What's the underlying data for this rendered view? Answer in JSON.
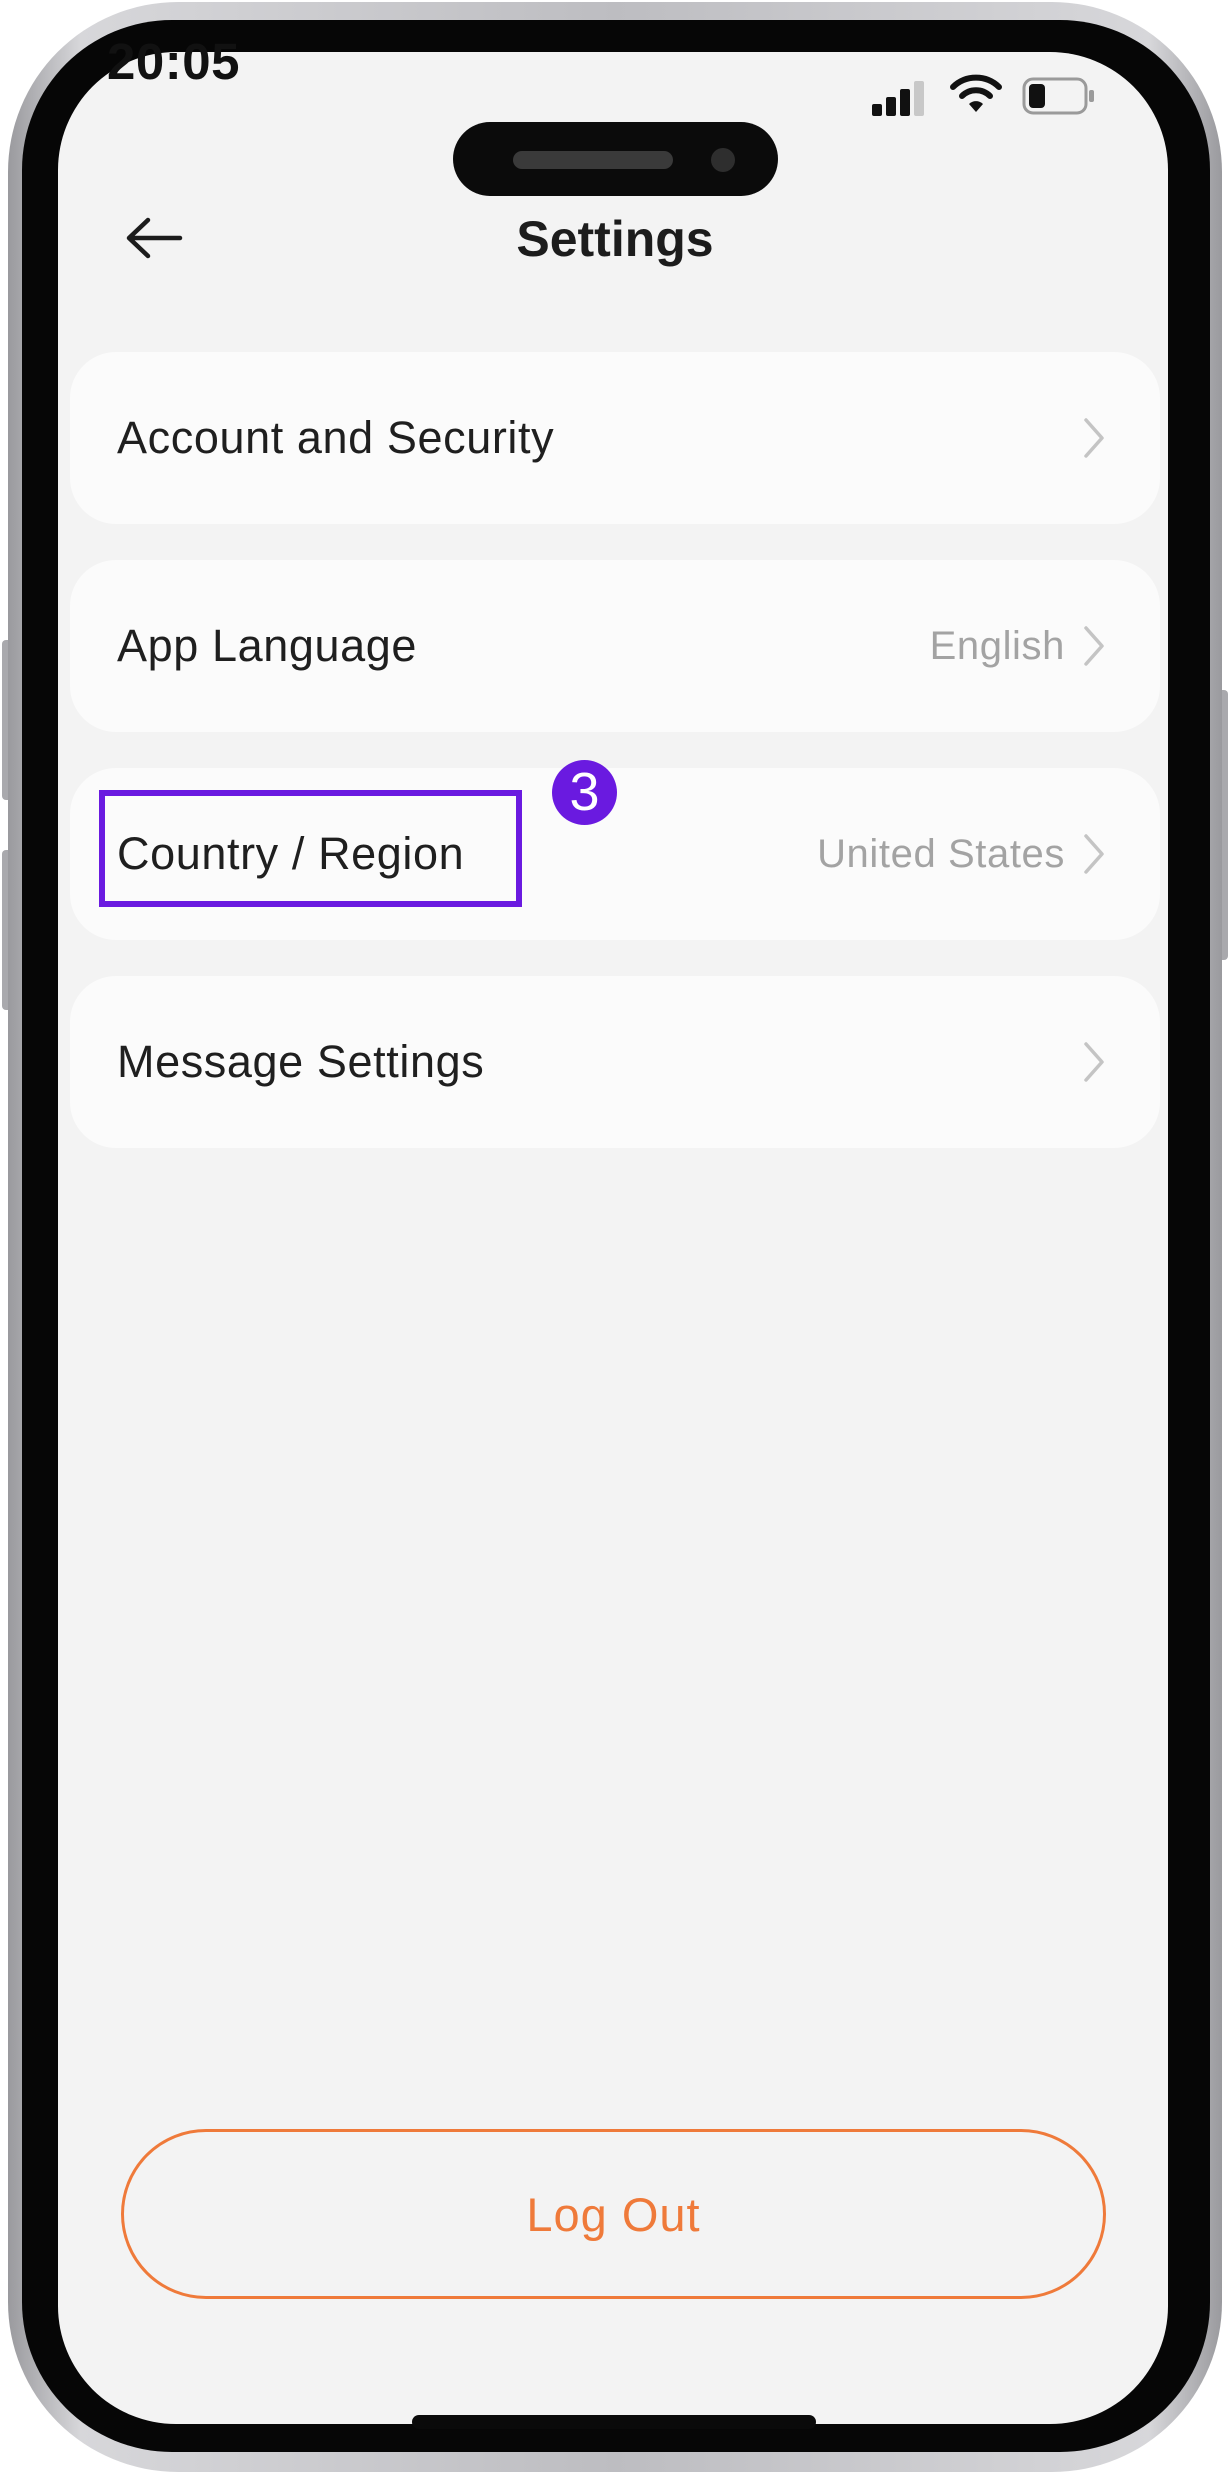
{
  "status_bar": {
    "time": "20:05",
    "signal_icon": "cellular-signal-icon",
    "wifi_icon": "wifi-icon",
    "battery_icon": "battery-icon",
    "battery_level": 0.3
  },
  "header": {
    "back_icon": "arrow-left-icon",
    "title": "Settings"
  },
  "settings_items": [
    {
      "label": "Account and Security",
      "value": ""
    },
    {
      "label": "App Language",
      "value": "English"
    },
    {
      "label": "Country / Region",
      "value": "United States"
    },
    {
      "label": "Message Settings",
      "value": ""
    }
  ],
  "annotation": {
    "step_number": "3",
    "highlighted_item": "Country / Region",
    "color": "#6a1ae0"
  },
  "logout": {
    "label": "Log Out",
    "color": "#ef7a3a"
  }
}
